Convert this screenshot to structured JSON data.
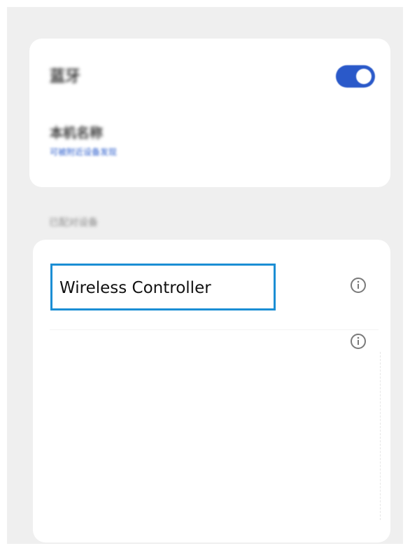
{
  "bluetooth": {
    "title": "蓝牙",
    "enabled": true,
    "device_name": "本机名称",
    "device_subtitle": "可被附近设备发现"
  },
  "paired_section": {
    "label": "已配对设备"
  },
  "devices": [
    {
      "label": "Wireless Controller",
      "highlighted": true
    },
    {
      "label": ""
    }
  ],
  "colors": {
    "accent": "#2a59c9",
    "highlight_border": "#1b8ed4",
    "background": "#efefef"
  },
  "icons": {
    "info": "info-circle-icon"
  }
}
